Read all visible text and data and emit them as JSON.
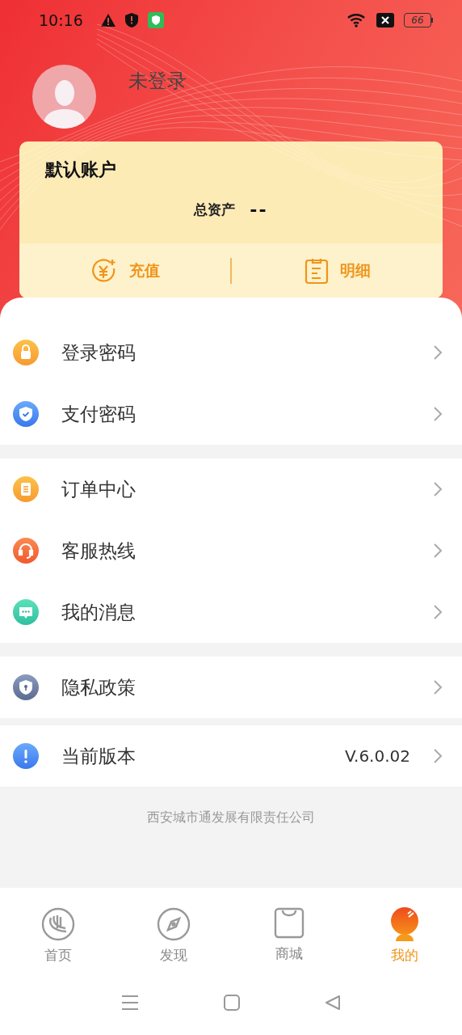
{
  "status_bar": {
    "time": "10:16",
    "battery": "66"
  },
  "profile": {
    "name": "未登录"
  },
  "account_card": {
    "title": "默认账户",
    "total_label": "总资产",
    "total_value": "--",
    "actions": [
      {
        "kind": "recharge",
        "label": "充值"
      },
      {
        "kind": "details",
        "label": "明细"
      }
    ]
  },
  "menu_groups": [
    [
      {
        "kind": "lock",
        "label": "登录密码"
      },
      {
        "kind": "shield",
        "label": "支付密码"
      }
    ],
    [
      {
        "kind": "order",
        "label": "订单中心"
      },
      {
        "kind": "headset",
        "label": "客服热线"
      },
      {
        "kind": "message",
        "label": "我的消息"
      }
    ],
    [
      {
        "kind": "privacy",
        "label": "隐私政策"
      }
    ],
    [
      {
        "kind": "info",
        "label": "当前版本",
        "value": "V.6.0.02"
      }
    ]
  ],
  "footer": "西安城市通发展有限责任公司",
  "tab_bar": [
    {
      "kind": "home",
      "label": "首页",
      "selected": false
    },
    {
      "kind": "discover",
      "label": "发现",
      "selected": false
    },
    {
      "kind": "shop",
      "label": "商城",
      "selected": false
    },
    {
      "kind": "mine",
      "label": "我的",
      "selected": true
    }
  ]
}
